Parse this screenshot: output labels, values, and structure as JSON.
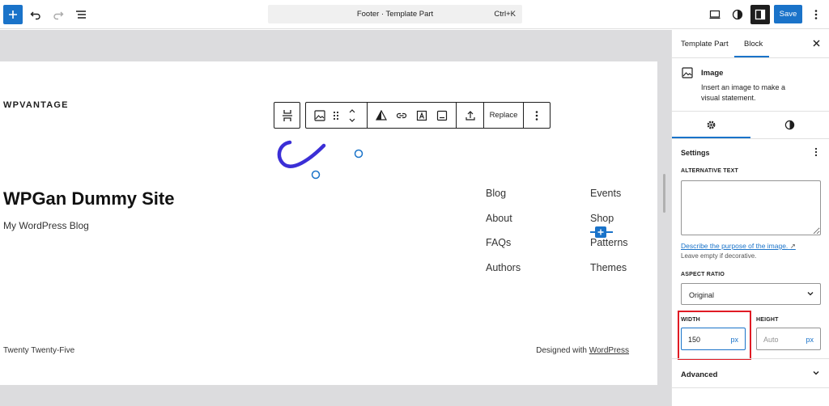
{
  "toolbar": {
    "add_icon": "plus-icon",
    "undo_icon": "undo-icon",
    "redo_icon": "redo-icon",
    "list_view_icon": "list-view-icon",
    "command_title": "Footer · Template Part",
    "command_shortcut": "Ctrl+K",
    "view_icon": "desktop-view-icon",
    "styles_icon": "contrast-icon",
    "settings_icon": "sidebar-toggle-icon",
    "save_label": "Save",
    "options_icon": "more-vertical-icon",
    "accent_color": "#1a73c9"
  },
  "block_toolbar": {
    "parent_icon": "template-part-icon",
    "image_icon": "image-icon",
    "drag_icon": "drag-handle-icon",
    "move_icons": "chevron-up-down-icon",
    "duotone_icon": "duotone-icon",
    "link_icon": "link-icon",
    "text_overlay_icon": "text-overlay-icon",
    "caption_icon": "caption-icon",
    "upload_icon": "upload-icon",
    "replace_label": "Replace",
    "more_icon": "more-vertical-icon"
  },
  "canvas": {
    "logo": "WPVANTAGE",
    "site_title": "WPGan Dummy Site",
    "tagline": "My WordPress Blog",
    "nav_col1": [
      "Blog",
      "About",
      "FAQs",
      "Authors"
    ],
    "nav_col2": [
      "Events",
      "Shop",
      "Patterns",
      "Themes"
    ],
    "footer_left": "Twenty Twenty-Five",
    "footer_right_prefix": "Designed with ",
    "footer_right_link": "WordPress",
    "spinner_color": "#3b2fd6"
  },
  "sidebar": {
    "tabs": [
      "Template Part",
      "Block"
    ],
    "close_icon": "close-icon",
    "block_icon": "image-icon",
    "block_title": "Image",
    "block_description": "Insert an image to make a visual statement.",
    "settings_tab_icon": "gear-icon",
    "styles_tab_icon": "contrast-icon",
    "settings_heading": "Settings",
    "alt_text_label": "ALTERNATIVE TEXT",
    "alt_text_value": "",
    "help_link": "Describe the purpose of the image.",
    "help_note": "Leave empty if decorative.",
    "aspect_label": "ASPECT RATIO",
    "aspect_value": "Original",
    "width_label": "WIDTH",
    "width_value": "150",
    "width_unit": "px",
    "height_label": "HEIGHT",
    "height_placeholder": "Auto",
    "height_unit": "px",
    "advanced_label": "Advanced",
    "highlight_color": "#e01b24"
  }
}
